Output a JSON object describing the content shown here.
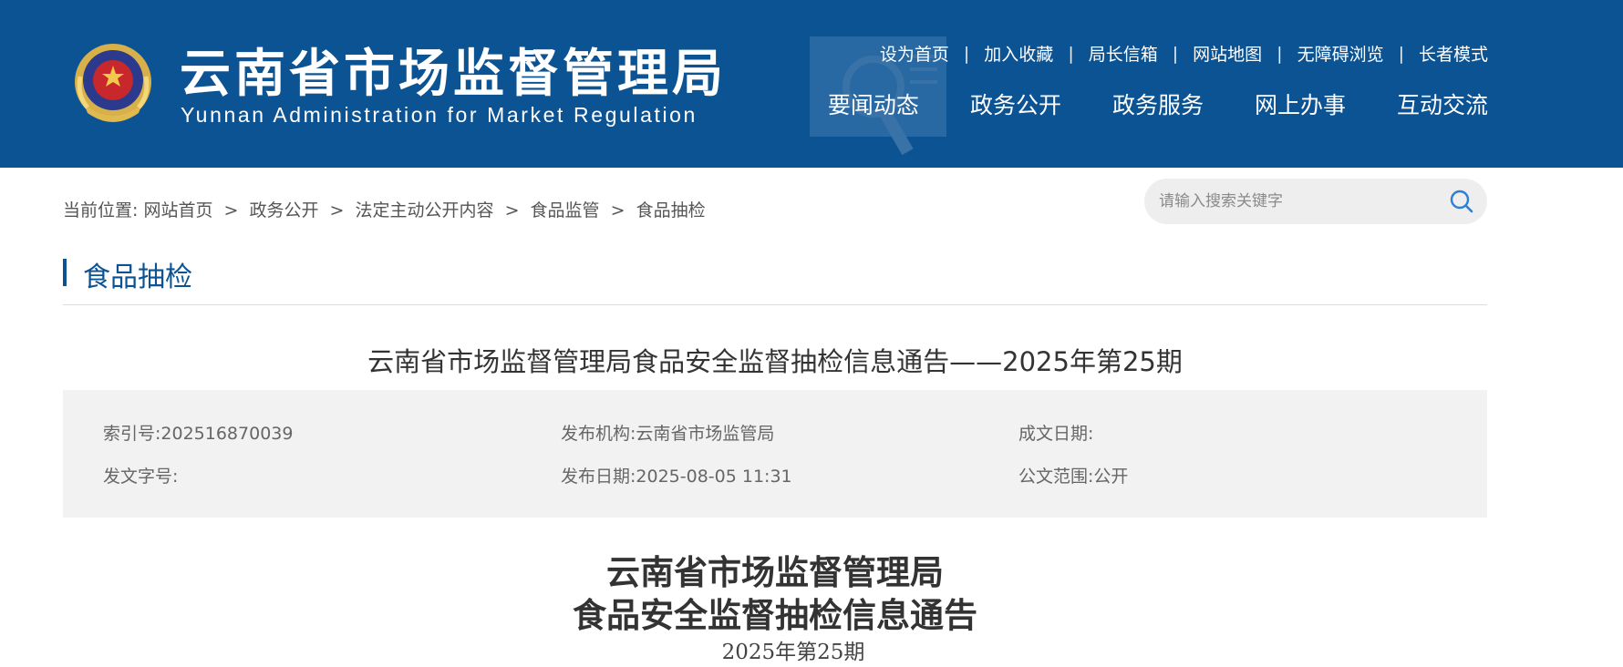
{
  "header": {
    "title_cn": "云南省市场监督管理局",
    "title_en": "Yunnan Administration for Market Regulation",
    "emblem_icon": "national-emblem-icon",
    "top_links": [
      "设为首页",
      "加入收藏",
      "局长信箱",
      "网站地图",
      "无障碍浏览",
      "长者模式"
    ],
    "separator": "|",
    "nav": [
      "要闻动态",
      "政务公开",
      "政务服务",
      "网上办事",
      "互动交流"
    ]
  },
  "breadcrumb": {
    "prefix": "当前位置:",
    "items": [
      "网站首页",
      "政务公开",
      "法定主动公开内容",
      "食品监管",
      "食品抽检"
    ],
    "separator": ">"
  },
  "search": {
    "placeholder": "请输入搜索关键字",
    "icon": "search-icon"
  },
  "section": {
    "title": "食品抽检"
  },
  "article": {
    "title": "云南省市场监督管理局食品安全监督抽检信息通告——2025年第25期",
    "meta": {
      "index_label": "索引号:",
      "index_value": "202516870039",
      "publisher_label": "发布机构:",
      "publisher_value": "云南省市场监管局",
      "written_date_label": "成文日期:",
      "written_date_value": "",
      "doc_number_label": "发文字号:",
      "doc_number_value": "",
      "publish_date_label": "发布日期:",
      "publish_date_value": "2025-08-05 11:31",
      "scope_label": "公文范围:",
      "scope_value": "公开"
    },
    "doc_heading_line1": "云南省市场监督管理局",
    "doc_heading_line2": "食品安全监督抽检信息通告",
    "doc_issue": "2025年第25期"
  },
  "colors": {
    "brand": "#0c5394",
    "meta_bg": "#f2f2f2",
    "search_bg": "#eeeeee"
  }
}
